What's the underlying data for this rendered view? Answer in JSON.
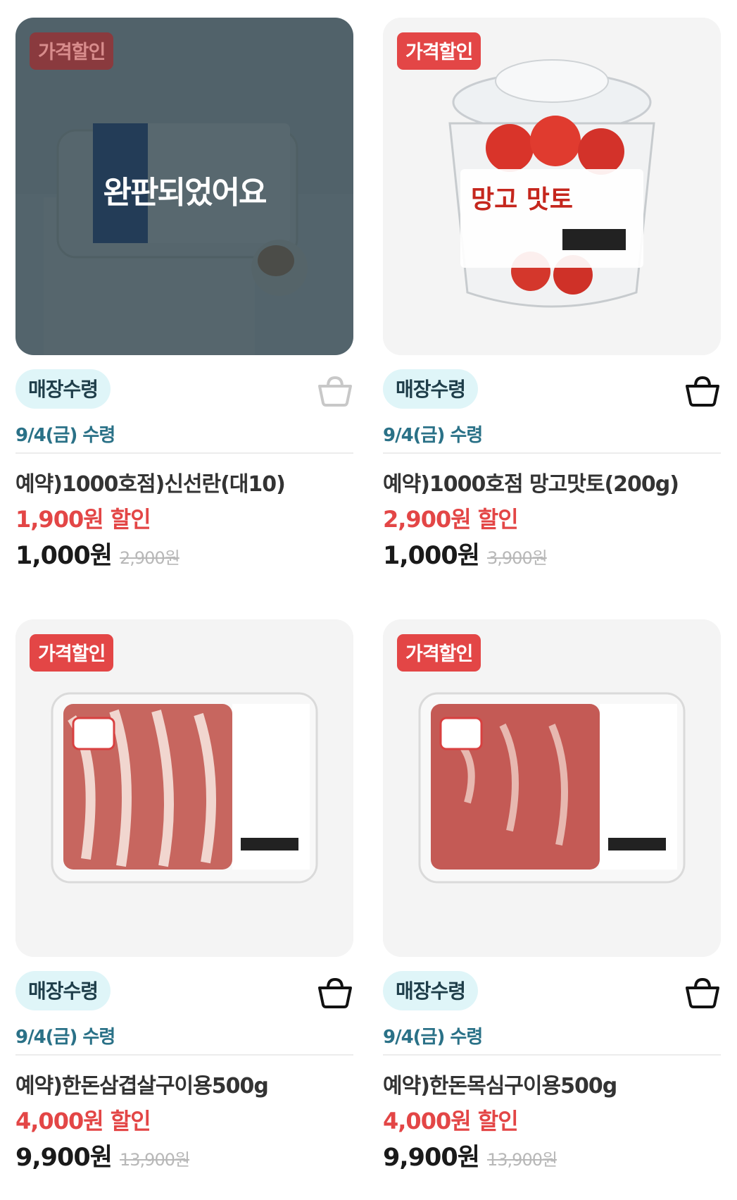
{
  "products": [
    {
      "badge": "가격할인",
      "sold_out": true,
      "sold_out_label": "완판되었어요",
      "pickup_tag": "매장수령",
      "pickup_date": "9/4(금) 수령",
      "title": "예약)1000호점)신선란(대10)",
      "discount": "1,900원 할인",
      "price": "1,000원",
      "original_price": "2,900원",
      "image_icon": "egg-carton-image",
      "cart_icon": "basket-icon-disabled"
    },
    {
      "badge": "가격할인",
      "sold_out": false,
      "pickup_tag": "매장수령",
      "pickup_date": "9/4(금) 수령",
      "title": "예약)1000호점 망고맛토(200g)",
      "discount": "2,900원 할인",
      "price": "1,000원",
      "original_price": "3,900원",
      "image_icon": "tomato-cup-image",
      "cart_icon": "basket-icon"
    },
    {
      "badge": "가격할인",
      "sold_out": false,
      "pickup_tag": "매장수령",
      "pickup_date": "9/4(금) 수령",
      "title": "예약)한돈삼겹살구이용500g",
      "discount": "4,000원 할인",
      "price": "9,900원",
      "original_price": "13,900원",
      "image_icon": "pork-belly-tray-image",
      "cart_icon": "basket-icon"
    },
    {
      "badge": "가격할인",
      "sold_out": false,
      "pickup_tag": "매장수령",
      "pickup_date": "9/4(금) 수령",
      "title": "예약)한돈목심구이용500g",
      "discount": "4,000원 할인",
      "price": "9,900원",
      "original_price": "13,900원",
      "image_icon": "pork-neck-tray-image",
      "cart_icon": "basket-icon"
    }
  ],
  "colors": {
    "discount_red": "#e34646",
    "pickup_tag_bg": "#dff5f8",
    "pickup_date": "#2a7187",
    "sold_out_overlay": "#243842"
  }
}
